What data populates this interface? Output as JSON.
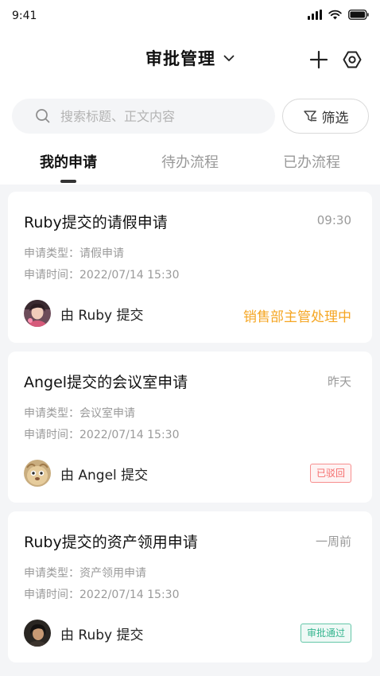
{
  "status_bar": {
    "time": "9:41"
  },
  "header": {
    "title": "审批管理",
    "title_icon": "chevron-down-icon",
    "add_icon": "plus-icon",
    "settings_icon": "settings-icon"
  },
  "search": {
    "placeholder": "搜索标题、正文内容",
    "value": ""
  },
  "filter": {
    "label": "筛选",
    "icon": "filter-icon"
  },
  "tabs": [
    {
      "label": "我的申请",
      "active": true
    },
    {
      "label": "待办流程",
      "active": false
    },
    {
      "label": "已办流程",
      "active": false
    }
  ],
  "colors": {
    "processing": "#f5a623",
    "rejected": "#f56c6c",
    "approved": "#35b58f"
  },
  "requests": [
    {
      "title": "Ruby提交的请假申请",
      "time": "09:30",
      "type_line": "申请类型：请假申请",
      "date_line": "申请时间：2022/07/14 15:30",
      "submitter": "由 Ruby 提交",
      "status": "销售部主管处理中",
      "status_kind": "processing"
    },
    {
      "title": "Angel提交的会议室申请",
      "time": "昨天",
      "type_line": "申请类型：会议室申请",
      "date_line": "申请时间：2022/07/14 15:30",
      "submitter": "由 Angel 提交",
      "status": "已驳回",
      "status_kind": "rejected"
    },
    {
      "title": "Ruby提交的资产领用申请",
      "time": "一周前",
      "type_line": "申请类型：资产领用申请",
      "date_line": "申请时间：2022/07/14 15:30",
      "submitter": "由 Ruby 提交",
      "status": "审批通过",
      "status_kind": "approved"
    }
  ]
}
